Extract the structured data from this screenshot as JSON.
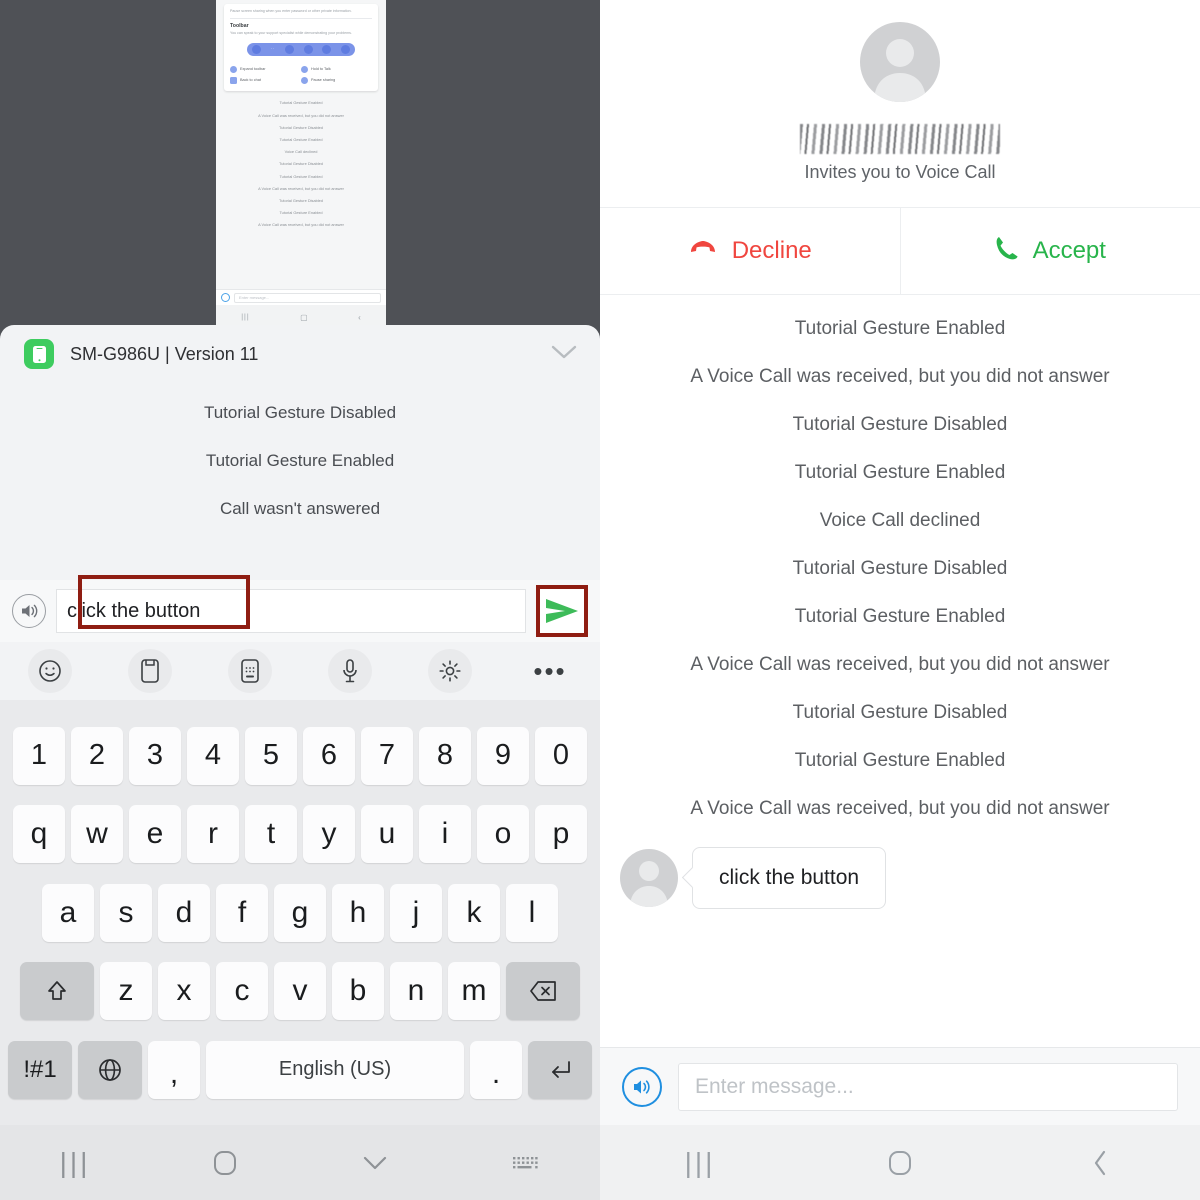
{
  "left": {
    "mockup": {
      "note": "Pause screen sharing when you enter password or other private information.",
      "toolbar_heading": "Toolbar",
      "toolbar_sub": "You can speak to your support specialist while demonstrating your problems.",
      "legend": [
        {
          "label": "Expand toolbar",
          "icon": "expand-toolbar-icon"
        },
        {
          "label": "Hold to Talk",
          "icon": "hold-to-talk-icon"
        },
        {
          "label": "Back to chat",
          "icon": "back-to-chat-icon"
        },
        {
          "label": "Pause sharing",
          "icon": "pause-sharing-icon"
        }
      ],
      "messages": [
        "Tutorial Gesture Enabled",
        "A Voice Call was received, but you did not answer",
        "Tutorial Gesture Disabled",
        "Tutorial Gesture Enabled",
        "Voice Call declined",
        "Tutorial Gesture Disabled",
        "Tutorial Gesture Enabled",
        "A Voice Call was received, but you did not answer",
        "Tutorial Gesture Disabled",
        "Tutorial Gesture Enabled",
        "A Voice Call was received, but you did not answer"
      ],
      "input_placeholder": "Enter message..."
    },
    "sheet": {
      "device_title": "SM-G986U | Version 11",
      "device_icon": "phone-device-icon",
      "collapse_icon": "chevron-down-icon",
      "messages": [
        "Tutorial Gesture Disabled",
        "Tutorial Gesture Enabled",
        "Call wasn't answered"
      ]
    },
    "input": {
      "speaker_icon": "speaker-icon",
      "value": "click the button",
      "placeholder": "Enter message...",
      "send_icon": "send-icon",
      "annotation_color": "#8f1d12"
    },
    "tools": [
      {
        "name": "emoji-icon",
        "glyph": "☺"
      },
      {
        "name": "clipboard-icon",
        "glyph": "⌸"
      },
      {
        "name": "sticker-icon",
        "glyph": "∷"
      },
      {
        "name": "microphone-icon",
        "glyph": "Ἲ4"
      },
      {
        "name": "settings-gear-icon",
        "glyph": "⚙"
      },
      {
        "name": "more-options-icon",
        "glyph": "•••"
      }
    ],
    "keyboard": {
      "row_numbers": [
        "1",
        "2",
        "3",
        "4",
        "5",
        "6",
        "7",
        "8",
        "9",
        "0"
      ],
      "row_top": [
        "q",
        "w",
        "e",
        "r",
        "t",
        "y",
        "u",
        "i",
        "o",
        "p"
      ],
      "row_home": [
        "a",
        "s",
        "d",
        "f",
        "g",
        "h",
        "j",
        "k",
        "l"
      ],
      "row_bottom": [
        "z",
        "x",
        "c",
        "v",
        "b",
        "n",
        "m"
      ],
      "shift_icon": "shift-key-icon",
      "backspace_icon": "backspace-key-icon",
      "symbols_label": "!#1",
      "globe_icon": "language-globe-icon",
      "comma": ",",
      "space_label": "English (US)",
      "period": ".",
      "enter_icon": "enter-key-icon"
    },
    "nav": [
      {
        "name": "recents-nav-icon"
      },
      {
        "name": "home-nav-icon"
      },
      {
        "name": "hide-keyboard-icon"
      },
      {
        "name": "keyboard-nav-icon"
      }
    ]
  },
  "right": {
    "call": {
      "avatar": "caller-avatar",
      "caller_name_redacted": "",
      "invite_text": "Invites you to Voice Call",
      "decline_label": "Decline",
      "decline_icon": "decline-call-icon",
      "decline_color": "#f0463f",
      "accept_label": "Accept",
      "accept_icon": "accept-call-icon",
      "accept_color": "#28b44b"
    },
    "messages": [
      "Tutorial Gesture Enabled",
      "A Voice Call was received, but you did not answer",
      "Tutorial Gesture Disabled",
      "Tutorial Gesture Enabled",
      "Voice Call declined",
      "Tutorial Gesture Disabled",
      "Tutorial Gesture Enabled",
      "A Voice Call was received, but you did not answer",
      "Tutorial Gesture Disabled",
      "Tutorial Gesture Enabled",
      "A Voice Call was received, but you did not answer"
    ],
    "bubble": {
      "text": "click the button",
      "avatar": "sender-avatar"
    },
    "input": {
      "speaker_icon": "speaker-icon",
      "placeholder": "Enter message..."
    },
    "nav": [
      {
        "name": "recents-nav-icon"
      },
      {
        "name": "home-nav-icon"
      },
      {
        "name": "back-nav-icon"
      }
    ]
  }
}
